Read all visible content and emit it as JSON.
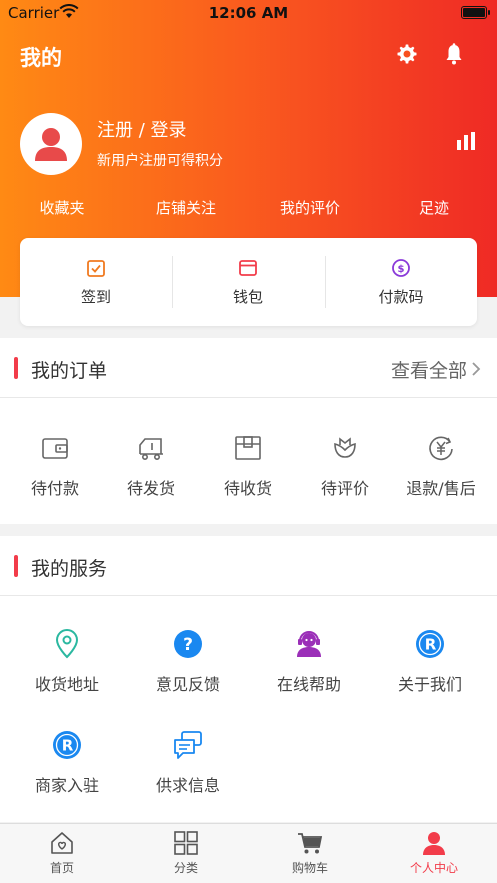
{
  "status": {
    "carrier": "Carrier",
    "time": "12:06 AM"
  },
  "header": {
    "title": "我的"
  },
  "user": {
    "login": "注册 / 登录",
    "promo": "新用户注册可得积分"
  },
  "quick_links": [
    "收藏夹",
    "店铺关注",
    "我的评价",
    "足迹"
  ],
  "card": [
    {
      "label": "签到",
      "icon": "check-calendar-icon",
      "color": "#f07a20"
    },
    {
      "label": "钱包",
      "icon": "wallet-icon",
      "color": "#f23c4a"
    },
    {
      "label": "付款码",
      "icon": "dollar-coin-icon",
      "color": "#8a3ad9"
    }
  ],
  "orders": {
    "title": "我的订单",
    "view_all": "查看全部",
    "items": [
      {
        "label": "待付款",
        "icon": "wallet-outline-icon"
      },
      {
        "label": "待发货",
        "icon": "truck-icon"
      },
      {
        "label": "待收货",
        "icon": "package-icon"
      },
      {
        "label": "待评价",
        "icon": "flower-icon"
      },
      {
        "label": "退款/售后",
        "icon": "yen-refund-icon"
      }
    ]
  },
  "services": {
    "title": "我的服务",
    "items": [
      {
        "label": "收货地址",
        "icon": "location-pin-icon",
        "color": "#2bb8a0"
      },
      {
        "label": "意见反馈",
        "icon": "question-icon",
        "color": "#1a88f0"
      },
      {
        "label": "在线帮助",
        "icon": "support-agent-icon",
        "color": "#9b2fb8"
      },
      {
        "label": "关于我们",
        "icon": "r-logo-icon",
        "color": "#1a88f0"
      },
      {
        "label": "商家入驻",
        "icon": "r-logo-icon",
        "color": "#1a88f0"
      },
      {
        "label": "供求信息",
        "icon": "chat-bubbles-icon",
        "color": "#1a88f0"
      }
    ]
  },
  "tabbar": [
    {
      "label": "首页",
      "icon": "home-icon"
    },
    {
      "label": "分类",
      "icon": "grid-icon"
    },
    {
      "label": "购物车",
      "icon": "cart-icon"
    },
    {
      "label": "个人中心",
      "icon": "user-icon",
      "active": true
    }
  ],
  "colors": {
    "accent": "#f23c4a",
    "gradient_start": "#ff8a14",
    "gradient_end": "#ef2a25"
  }
}
